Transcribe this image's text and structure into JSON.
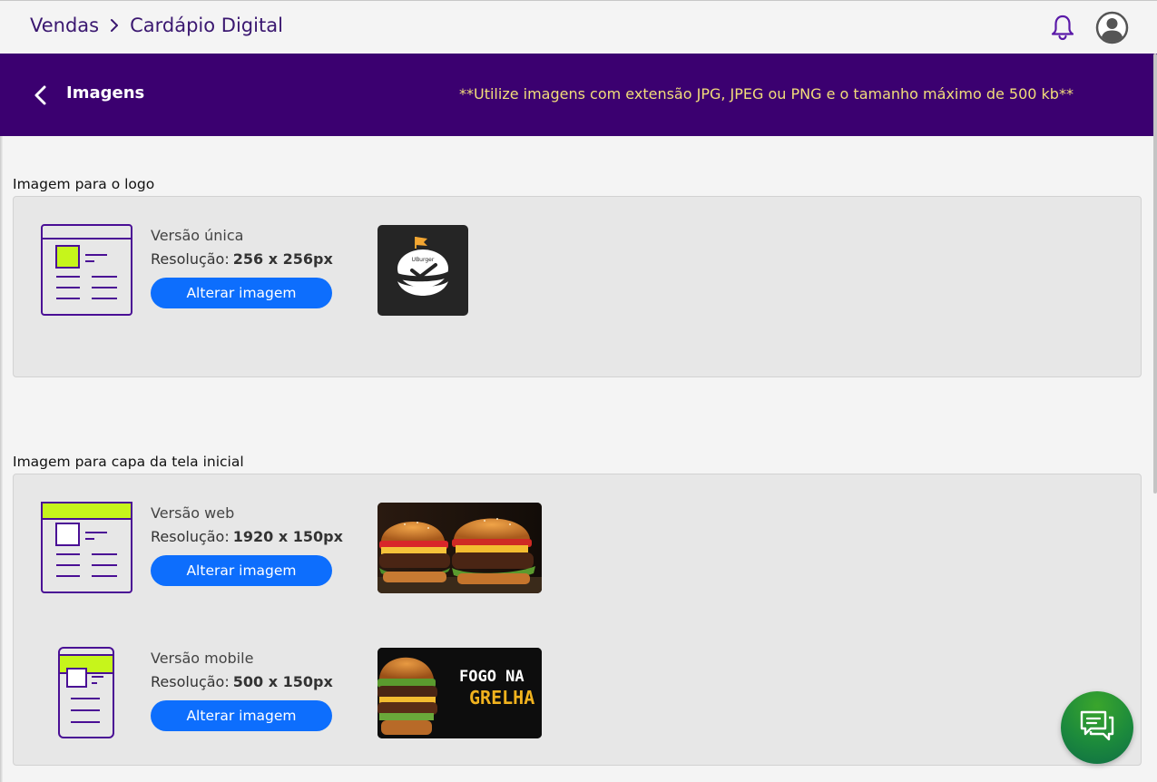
{
  "breadcrumb": {
    "parent": "Vendas",
    "current": "Cardápio Digital"
  },
  "header": {
    "title": "Imagens",
    "note": "**Utilize imagens com extensão JPG, JPEG ou PNG e o tamanho máximo de 500 kb**"
  },
  "logo_section": {
    "label": "Imagem para o logo",
    "version": "Versão única",
    "resolution_label": "Resolução:",
    "resolution": "256 x 256px",
    "button": "Alterar imagem",
    "logo_text": "UBurger"
  },
  "cover_section": {
    "label": "Imagem para capa da tela inicial",
    "web": {
      "version": "Versão web",
      "resolution_label": "Resolução:",
      "resolution": "1920 x 150px",
      "button": "Alterar imagem"
    },
    "mobile": {
      "version": "Versão mobile",
      "resolution_label": "Resolução:",
      "resolution": "500 x 150px",
      "button": "Alterar imagem",
      "banner_line1": "FOGO NA",
      "banner_line2": "GRELHA"
    }
  },
  "colors": {
    "brand_purple": "#3b0070",
    "accent_green": "#c6f51b",
    "button_blue": "#0d6efd",
    "note_yellow": "#f2de7a",
    "chat_green": "#1c8a3c"
  },
  "icons": [
    "chevron-right-icon",
    "bell-icon",
    "user-avatar-icon",
    "back-arrow-icon",
    "layout-logo-icon",
    "layout-web-cover-icon",
    "layout-mobile-cover-icon",
    "chat-icon"
  ]
}
